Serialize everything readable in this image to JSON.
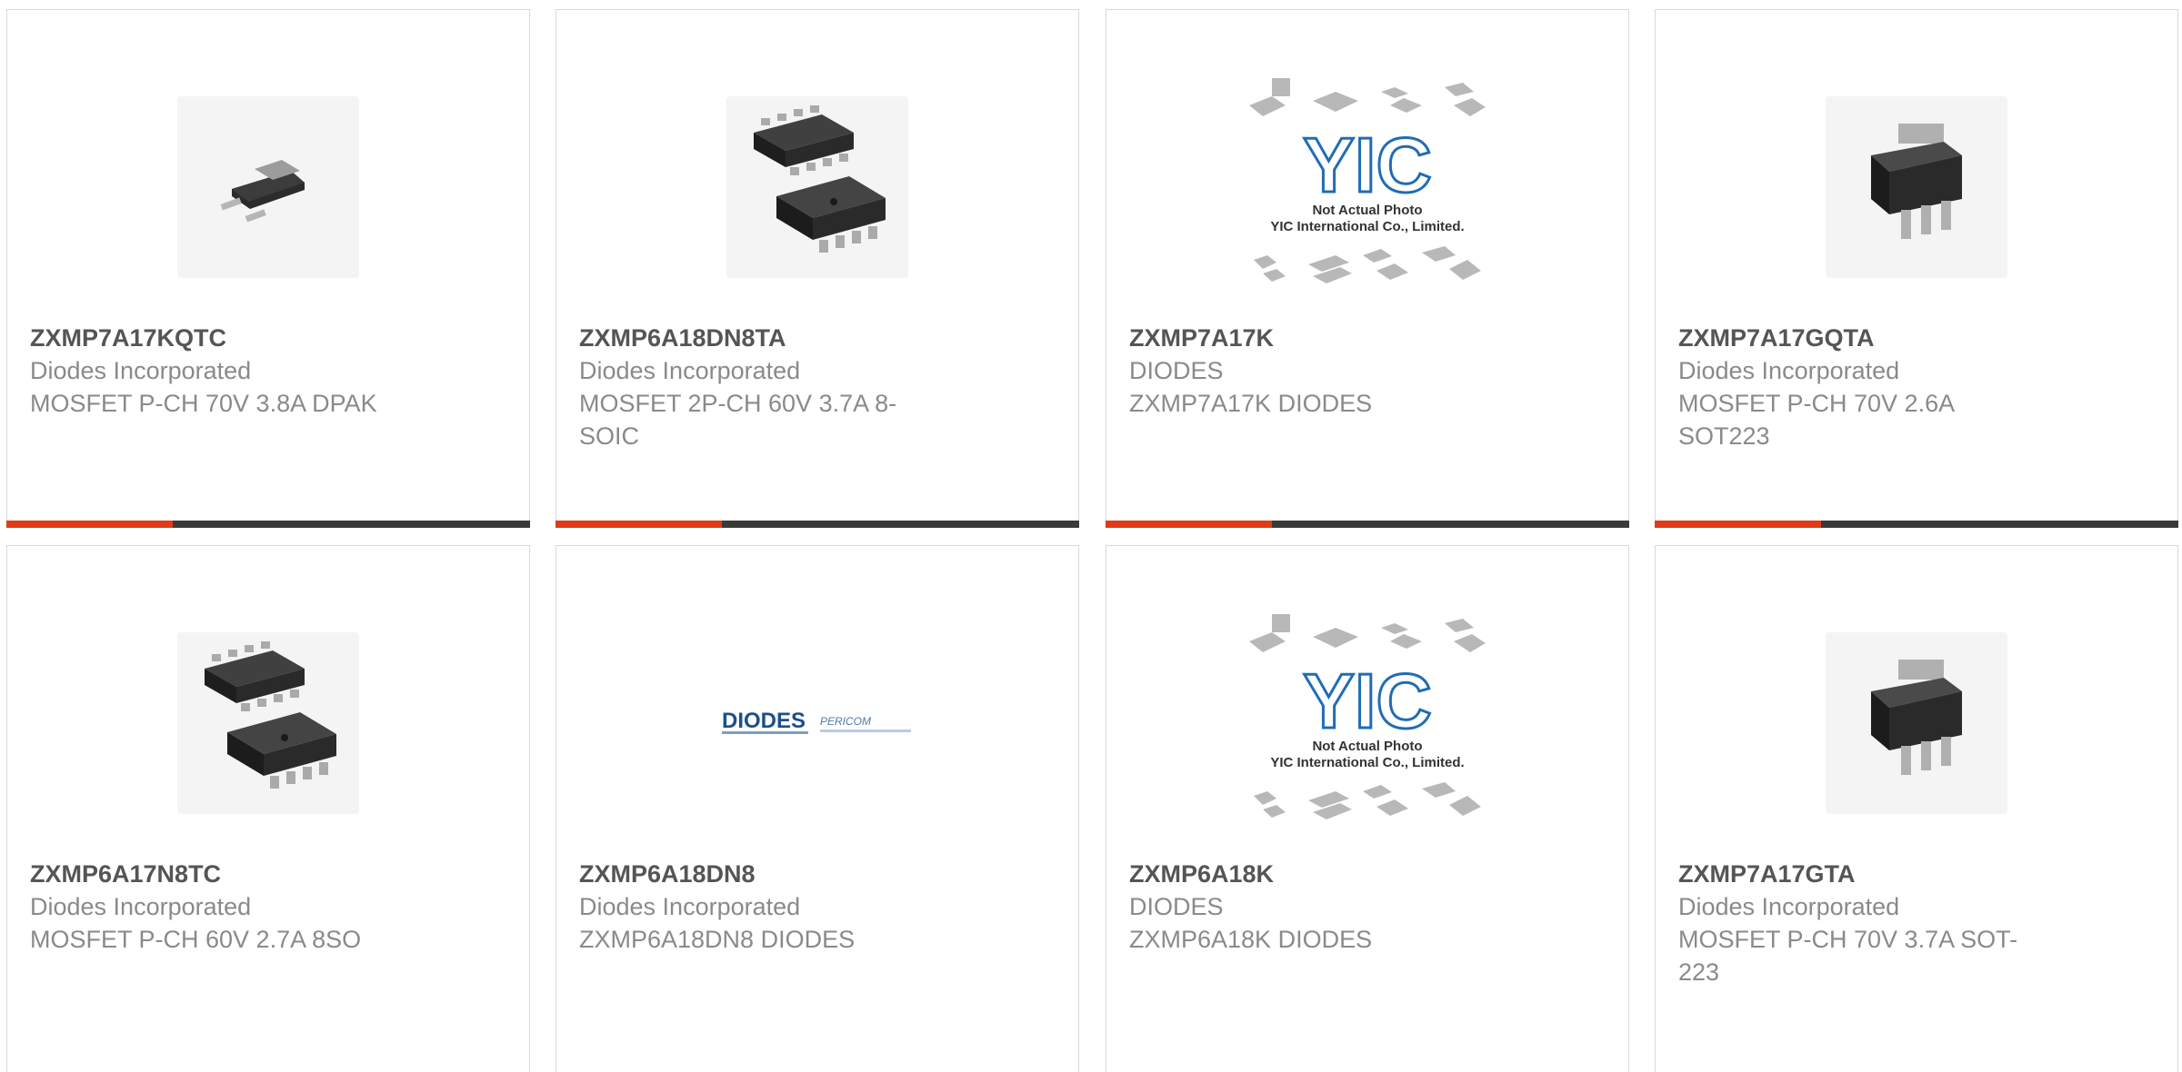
{
  "products": [
    {
      "part_number": "ZXMP7A17KQTC",
      "manufacturer": "Diodes Incorporated",
      "description": "MOSFET P-CH 70V 3.8A DPAK",
      "image": "dpak-package-icon"
    },
    {
      "part_number": "ZXMP6A18DN8TA",
      "manufacturer": "Diodes Incorporated",
      "description": "MOSFET 2P-CH 60V 3.7A 8-SOIC",
      "image": "soic8-package-icon"
    },
    {
      "part_number": "ZXMP7A17K",
      "manufacturer": "DIODES",
      "description": "ZXMP7A17K DIODES",
      "image": "yic-placeholder-image",
      "placeholder_text": [
        "Not Actual Photo",
        "YIC International Co., Limited."
      ],
      "logo_text": "YIC"
    },
    {
      "part_number": "ZXMP7A17GQTA",
      "manufacturer": "Diodes Incorporated",
      "description": "MOSFET P-CH 70V 2.6A SOT223",
      "image": "sot223-package-icon"
    },
    {
      "part_number": "ZXMP6A17N8TC",
      "manufacturer": "Diodes Incorporated",
      "description": "MOSFET P-CH 60V 2.7A 8SO",
      "image": "soic8-package-icon"
    },
    {
      "part_number": "ZXMP6A18DN8",
      "manufacturer": "Diodes Incorporated",
      "description": "ZXMP6A18DN8 DIODES",
      "image": "diodes-pericom-logo",
      "logo_text": [
        "DIODES",
        "PERICOM"
      ]
    },
    {
      "part_number": "ZXMP6A18K",
      "manufacturer": "DIODES",
      "description": "ZXMP6A18K DIODES",
      "image": "yic-placeholder-image",
      "placeholder_text": [
        "Not Actual Photo",
        "YIC International Co., Limited."
      ],
      "logo_text": "YIC"
    },
    {
      "part_number": "ZXMP7A17GTA",
      "manufacturer": "Diodes Incorporated",
      "description": "MOSFET P-CH 70V 3.7A SOT-223",
      "image": "sot223-package-icon"
    }
  ],
  "colors": {
    "accent": "#e03b18",
    "bar": "#3a3a3a",
    "part_number": "#555555",
    "text": "#8a8a8a",
    "border": "#d9d9d9"
  }
}
